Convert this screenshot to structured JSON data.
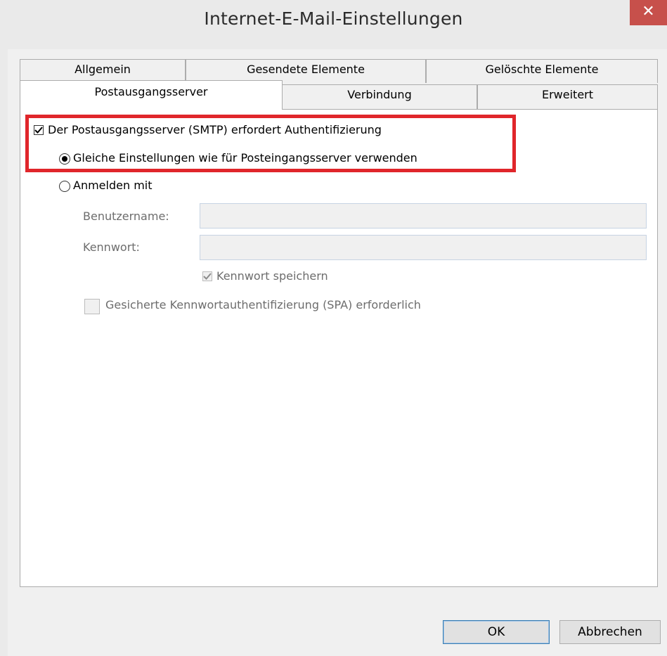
{
  "window": {
    "title": "Internet-E-Mail-Einstellungen",
    "close_icon": "close-icon",
    "close_color": "#c7504b"
  },
  "tabs": {
    "row_top": [
      "Allgemein",
      "Gesendete Elemente",
      "Gelöschte Elemente"
    ],
    "row_bottom": [
      "Postausgangsserver",
      "Verbindung",
      "Erweitert"
    ],
    "active": "Postausgangsserver"
  },
  "smtp_auth": {
    "label": "Der Postausgangsserver (SMTP) erfordert Authentifizierung",
    "checked": true
  },
  "same_settings": {
    "label": "Gleiche Einstellungen wie für Posteingangsserver verwenden",
    "selected": true
  },
  "login_with": {
    "label": "Anmelden mit",
    "selected": false
  },
  "username": {
    "label": "Benutzername:",
    "value": ""
  },
  "password": {
    "label": "Kennwort:",
    "value": ""
  },
  "save_password": {
    "label": "Kennwort speichern",
    "checked": true,
    "disabled": true
  },
  "spa": {
    "label": "Gesicherte Kennwortauthentifizierung (SPA) erforderlich",
    "checked": false,
    "disabled": true
  },
  "buttons": {
    "ok": "OK",
    "cancel": "Abbrechen"
  },
  "highlight_color": "#e0262b"
}
